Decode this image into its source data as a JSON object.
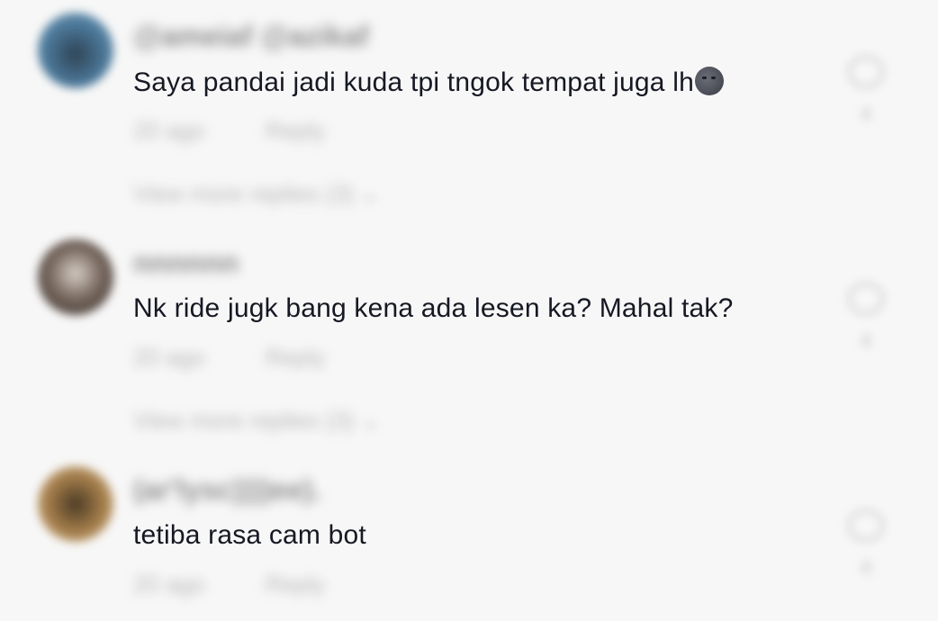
{
  "comments": [
    {
      "username": "@ameiaf @azikaf",
      "text": "Saya pandai jadi kuda tpi tngok tempat juga lh",
      "emoji": "new-moon-face-emoji",
      "time": "20 ago",
      "reply_label": "Reply",
      "view_replies": "View more replies (3) ⌄",
      "like_count": "4",
      "avatar_color": "#3f6a8a"
    },
    {
      "username": "nnnnnn",
      "text": "Nk ride jugk bang kena ada lesen ka? Mahal tak?",
      "time": "20 ago",
      "reply_label": "Reply",
      "view_replies": "View more replies (3) ⌄",
      "like_count": "4",
      "avatar_color": "#4b3d37"
    },
    {
      "username": "(ar'lysc))))ee).",
      "text": "tetiba rasa cam bot",
      "time": "20 ago",
      "reply_label": "Reply",
      "like_count": "4",
      "avatar_color": "#9a7440"
    }
  ]
}
